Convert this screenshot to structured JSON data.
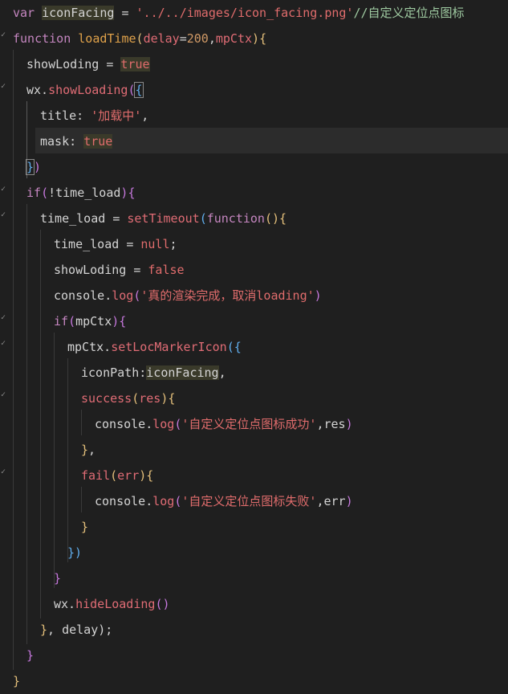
{
  "lines": [
    {
      "id": "l1",
      "segments": [
        [
          "var ",
          "kw"
        ],
        [
          "iconFacing",
          "def_sel"
        ],
        [
          " = ",
          "def"
        ],
        [
          "'../../images/icon_facing.png'",
          "str"
        ],
        [
          "//自定义定位点图标",
          "cmt"
        ]
      ]
    },
    {
      "id": "l2",
      "segments": [
        [
          "function ",
          "kw"
        ],
        [
          "loadTime",
          "fn"
        ],
        [
          "(",
          "br1"
        ],
        [
          "delay",
          "param"
        ],
        [
          "=",
          "def"
        ],
        [
          "200",
          "num"
        ],
        [
          ",",
          "def"
        ],
        [
          "mpCtx",
          "param"
        ],
        [
          ")",
          "br1"
        ],
        [
          "{",
          "br1"
        ]
      ]
    },
    {
      "id": "l3",
      "segments": [
        [
          "showLoding ",
          "def"
        ],
        [
          "= ",
          "def"
        ],
        [
          "true",
          "bool_sel"
        ]
      ]
    },
    {
      "id": "l4",
      "segments": [
        [
          "wx.",
          "def"
        ],
        [
          "showLoading",
          "meth"
        ],
        [
          "(",
          "br2"
        ],
        [
          "{",
          "br3box"
        ]
      ]
    },
    {
      "id": "l5",
      "segments": [
        [
          "title",
          "prop"
        ],
        [
          ": ",
          "def"
        ],
        [
          "'加载中'",
          "str"
        ],
        [
          ",",
          "def"
        ]
      ]
    },
    {
      "id": "l6",
      "segments": [
        [
          "mask",
          "prop"
        ],
        [
          ": ",
          "def"
        ],
        [
          "true",
          "bool_sel"
        ]
      ]
    },
    {
      "id": "l7",
      "segments": [
        [
          "}",
          "br3box"
        ],
        [
          ")",
          "br2"
        ]
      ]
    },
    {
      "id": "l8",
      "segments": [
        [
          "if",
          "kw"
        ],
        [
          "(",
          "br2"
        ],
        [
          "!time_load",
          "def"
        ],
        [
          ")",
          "br2"
        ],
        [
          "{",
          "br2"
        ]
      ]
    },
    {
      "id": "l9",
      "segments": [
        [
          "time_load ",
          "def"
        ],
        [
          "= ",
          "def"
        ],
        [
          "setTimeout",
          "meth"
        ],
        [
          "(",
          "br3"
        ],
        [
          "function",
          "kw"
        ],
        [
          "()",
          "br1"
        ],
        [
          "{",
          "br1"
        ]
      ]
    },
    {
      "id": "l10",
      "segments": [
        [
          "time_load ",
          "def"
        ],
        [
          "= ",
          "def"
        ],
        [
          "null",
          "bool"
        ],
        [
          ";",
          "def"
        ]
      ]
    },
    {
      "id": "l11",
      "segments": [
        [
          "showLoding ",
          "def"
        ],
        [
          "= ",
          "def"
        ],
        [
          "false",
          "bool"
        ]
      ]
    },
    {
      "id": "l12",
      "segments": [
        [
          "console.",
          "def"
        ],
        [
          "log",
          "meth"
        ],
        [
          "(",
          "br2"
        ],
        [
          "'真的渲染完成，取消loading'",
          "str"
        ],
        [
          ")",
          "br2"
        ]
      ]
    },
    {
      "id": "l13",
      "segments": [
        [
          "if",
          "kw"
        ],
        [
          "(",
          "br2"
        ],
        [
          "mpCtx",
          "def"
        ],
        [
          ")",
          "br2"
        ],
        [
          "{",
          "br2"
        ]
      ]
    },
    {
      "id": "l14",
      "segments": [
        [
          "mpCtx.",
          "def"
        ],
        [
          "setLocMarkerIcon",
          "meth"
        ],
        [
          "(",
          "br3"
        ],
        [
          "{",
          "br3"
        ]
      ]
    },
    {
      "id": "l15",
      "segments": [
        [
          "iconPath",
          "prop"
        ],
        [
          ":",
          "def"
        ],
        [
          "iconFacing",
          "def_sel"
        ],
        [
          ",",
          "def"
        ]
      ]
    },
    {
      "id": "l16",
      "segments": [
        [
          "success",
          "meth"
        ],
        [
          "(",
          "br1"
        ],
        [
          "res",
          "param"
        ],
        [
          ")",
          "br1"
        ],
        [
          "{",
          "br1"
        ]
      ]
    },
    {
      "id": "l17",
      "segments": [
        [
          "console.",
          "def"
        ],
        [
          "log",
          "meth"
        ],
        [
          "(",
          "br2"
        ],
        [
          "'自定义定位点图标成功'",
          "str"
        ],
        [
          ",res",
          "def"
        ],
        [
          ")",
          "br2"
        ]
      ]
    },
    {
      "id": "l18",
      "segments": [
        [
          "}",
          "br1"
        ],
        [
          ",",
          "def"
        ]
      ]
    },
    {
      "id": "l19",
      "segments": [
        [
          "fail",
          "meth"
        ],
        [
          "(",
          "br1"
        ],
        [
          "err",
          "param"
        ],
        [
          ")",
          "br1"
        ],
        [
          "{",
          "br1"
        ]
      ]
    },
    {
      "id": "l20",
      "segments": [
        [
          "console.",
          "def"
        ],
        [
          "log",
          "meth"
        ],
        [
          "(",
          "br2"
        ],
        [
          "'自定义定位点图标失败'",
          "str"
        ],
        [
          ",err",
          "def"
        ],
        [
          ")",
          "br2"
        ]
      ]
    },
    {
      "id": "l21",
      "segments": [
        [
          "}",
          "br1"
        ]
      ]
    },
    {
      "id": "l22",
      "segments": [
        [
          "}",
          "br3"
        ],
        [
          ")",
          "br3"
        ]
      ]
    },
    {
      "id": "l23",
      "segments": [
        [
          "}",
          "br2"
        ]
      ]
    },
    {
      "id": "l24",
      "segments": [
        [
          "wx.",
          "def"
        ],
        [
          "hideLoading",
          "meth"
        ],
        [
          "()",
          "br2"
        ]
      ]
    },
    {
      "id": "l25",
      "segments": [
        [
          "}",
          "br1"
        ],
        [
          ", delay",
          ""
        ],
        [
          ");",
          "def"
        ]
      ]
    },
    {
      "id": "l26",
      "segments": [
        [
          "}",
          "br2"
        ]
      ]
    },
    {
      "id": "l27",
      "segments": [
        [
          "}",
          "br1"
        ]
      ]
    }
  ]
}
